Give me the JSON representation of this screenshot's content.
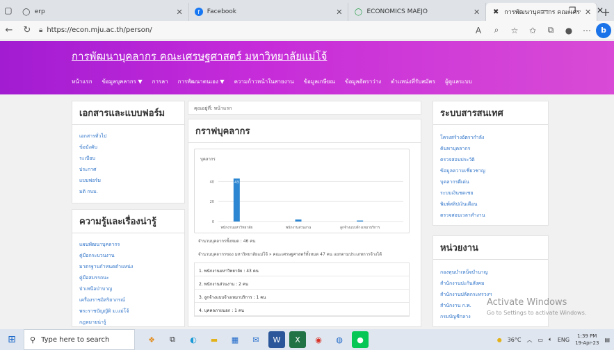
{
  "browser": {
    "tabs": [
      {
        "label": "erp",
        "icon": "globe-icon",
        "width": 270
      },
      {
        "label": "Facebook",
        "icon": "facebook-icon",
        "width": 250
      },
      {
        "label": "ECONOMICS MAEJO",
        "icon": "globe-icon",
        "width": 215
      },
      {
        "label": "การพัฒนาบุคลากร คณะเศรษฐศาสตร์",
        "icon": "site-logo-icon",
        "width": 160,
        "active": true
      }
    ],
    "url": "https://econ.mju.ac.th/person/"
  },
  "site": {
    "title": "การพัฒนาบุคลากร คณะเศรษฐศาสตร์ มหาวิทยาลัยแม่โจ้",
    "nav": [
      "หน้าแรก",
      "ข้อมูลบุคลากร ▼",
      "การลา",
      "การพัฒนาตนเอง ▼",
      "ความก้าวหน้าในสายงาน",
      "ข้อมูลเกษียณ",
      "ข้อมูลอัตราว่าง",
      "ตำแหน่งที่รับสมัคร",
      "ผู้ดูแลระบบ"
    ]
  },
  "left": {
    "docs_title": "เอกสารและแบบฟอร์ม",
    "docs": [
      "เอกสารทั่วไป",
      "ข้อบังคับ",
      "ระเบียบ",
      "ประกาศ",
      "แบบฟอร์ม",
      "มติ กบม."
    ],
    "knowledge_title": "ความรู้และเรื่องน่ารู้",
    "knowledge": [
      "แผนพัฒนาบุคลากร",
      "คู่มือกระบวนงาน",
      "มาตรฐานกำหนดตำแหน่ง",
      "คู่มือสมรรถนะ",
      "ป่าเหนือป่าบาญ",
      "เครื่องราชอิสริยาภรณ์",
      "พระราชบัญญัติ ม.แม่โจ้",
      "กฎหมายน่ารู้"
    ]
  },
  "center": {
    "breadcrumb": "คุณอยู่ที่: หน้าแรก",
    "title": "กราฟบุคลากร",
    "total": "จำนวนบุคลากรทั้งหมด : 46 คน",
    "summary": "จำนวนบุคลากรของ มหาวิทยาลัยแม่โจ้ » คณะเศรษฐศาสตร์ทั้งหมด 47 คน แยกตามประเภทการจ้างได้",
    "rows": [
      "1. พนักงานมหาวิทยาลัย : 43 คน",
      "2. พนักงานส่วนงาน : 2 คน",
      "3. ลูกจ้างแบบจ้างเหมาบริการ : 1 คน",
      "4. บุคคลภายนอก : 1 คน"
    ]
  },
  "chart_data": {
    "type": "bar",
    "title": "บุคลากร",
    "categories": [
      "พนักงานมหาวิทยาลัย",
      "พนักงานส่วนงาน",
      "ลูกจ้างแบบจ้างเหมาบริการ"
    ],
    "values": [
      43,
      2,
      1
    ],
    "data_labels": [
      "43"
    ],
    "ylim": [
      0,
      50
    ],
    "yticks": [
      0,
      20,
      40
    ],
    "grid": true,
    "color": "#2d86d1"
  },
  "right": {
    "info_title": "ระบบสารสนเทศ",
    "info": [
      "โครงสร้างอัตรากำลัง",
      "ค้นหาบุคลากร",
      "ตรวจสอบประวัติ",
      "ข้อมูลความเชี่ยวชาญ",
      "บุคลากรดีเด่น",
      "ระบบเงินชดเชย",
      "พิมพ์สลิปเงินเดือน",
      "ตรวจสอบเวลาทำงาน"
    ],
    "units_title": "หน่วยงาน",
    "units": [
      "กองทุนบำเหน็จบำนาญ",
      "สำนักงานปะกันสังคม",
      "สำนักงานปลัดกระทรวงฯ",
      "สำนักงาน ก.พ.",
      "กรมบัญชีกลาง"
    ]
  },
  "watermark": {
    "line1": "Activate Windows",
    "line2": "Go to Settings to activate Windows."
  },
  "taskbar": {
    "search_placeholder": "Type here to search",
    "temp": "36°C",
    "lang": "ENG",
    "time": "1:39 PM",
    "date": "19-Apr-23"
  },
  "colors": {
    "header_start": "#a21cd2",
    "header_end": "#d94bd6",
    "link": "#2e73c8",
    "bar": "#2d86d1"
  }
}
